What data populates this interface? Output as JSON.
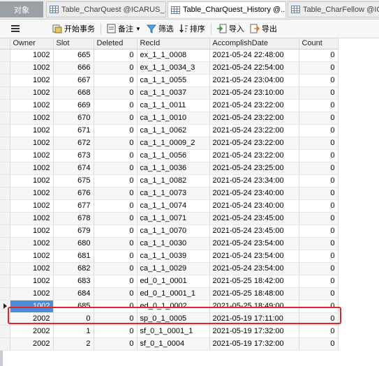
{
  "tabs": {
    "objects": "对象",
    "tab1": "Table_CharQuest @ICARUS_...",
    "tab2": "Table_CharQuest_History @...",
    "tab3": "Table_CharFellow @ICARUS"
  },
  "toolbar": {
    "begin_transaction": "开始事务",
    "note": "备注",
    "filter": "筛选",
    "sort": "排序",
    "import": "导入",
    "export": "导出"
  },
  "columns": [
    "Owner",
    "Slot",
    "Deleted",
    "RecId",
    "AccomplishDate",
    "Count"
  ],
  "rows": [
    [
      "1002",
      "665",
      "0",
      "ex_1_1_0008",
      "2021-05-24 22:48:00",
      "0"
    ],
    [
      "1002",
      "666",
      "0",
      "ex_1_1_0034_3",
      "2021-05-24 22:54:00",
      "0"
    ],
    [
      "1002",
      "667",
      "0",
      "ca_1_1_0055",
      "2021-05-24 23:04:00",
      "0"
    ],
    [
      "1002",
      "668",
      "0",
      "ca_1_1_0037",
      "2021-05-24 23:10:00",
      "0"
    ],
    [
      "1002",
      "669",
      "0",
      "ca_1_1_0011",
      "2021-05-24 23:22:00",
      "0"
    ],
    [
      "1002",
      "670",
      "0",
      "ca_1_1_0010",
      "2021-05-24 23:22:00",
      "0"
    ],
    [
      "1002",
      "671",
      "0",
      "ca_1_1_0062",
      "2021-05-24 23:22:00",
      "0"
    ],
    [
      "1002",
      "672",
      "0",
      "ca_1_1_0009_2",
      "2021-05-24 23:22:00",
      "0"
    ],
    [
      "1002",
      "673",
      "0",
      "ca_1_1_0056",
      "2021-05-24 23:22:00",
      "0"
    ],
    [
      "1002",
      "674",
      "0",
      "ca_1_1_0036",
      "2021-05-24 23:25:00",
      "0"
    ],
    [
      "1002",
      "675",
      "0",
      "ca_1_1_0082",
      "2021-05-24 23:34:00",
      "0"
    ],
    [
      "1002",
      "676",
      "0",
      "ca_1_1_0073",
      "2021-05-24 23:40:00",
      "0"
    ],
    [
      "1002",
      "677",
      "0",
      "ca_1_1_0074",
      "2021-05-24 23:40:00",
      "0"
    ],
    [
      "1002",
      "678",
      "0",
      "ca_1_1_0071",
      "2021-05-24 23:45:00",
      "0"
    ],
    [
      "1002",
      "679",
      "0",
      "ca_1_1_0070",
      "2021-05-24 23:45:00",
      "0"
    ],
    [
      "1002",
      "680",
      "0",
      "ca_1_1_0030",
      "2021-05-24 23:54:00",
      "0"
    ],
    [
      "1002",
      "681",
      "0",
      "ca_1_1_0039",
      "2021-05-24 23:54:00",
      "0"
    ],
    [
      "1002",
      "682",
      "0",
      "ca_1_1_0029",
      "2021-05-24 23:54:00",
      "0"
    ],
    [
      "1002",
      "683",
      "0",
      "ed_0_1_0001",
      "2021-05-25 18:42:00",
      "0"
    ],
    [
      "1002",
      "684",
      "0",
      "ed_0_1_0001_1",
      "2021-05-25 18:48:00",
      "0"
    ],
    [
      "1002",
      "685",
      "0",
      "ed_0_1_0002",
      "2021-05-25 18:49:00",
      "0"
    ],
    [
      "2002",
      "0",
      "0",
      "sp_0_1_0005",
      "2021-05-19 17:11:00",
      "0"
    ],
    [
      "2002",
      "1",
      "0",
      "sf_0_1_0001_1",
      "2021-05-19 17:32:00",
      "0"
    ],
    [
      "2002",
      "2",
      "0",
      "sf_0_1_0004",
      "2021-05-19 17:32:00",
      "0"
    ]
  ],
  "selected_row_index": 20,
  "accent_color": "#4c8fd6",
  "highlight_color": "#e8202a"
}
